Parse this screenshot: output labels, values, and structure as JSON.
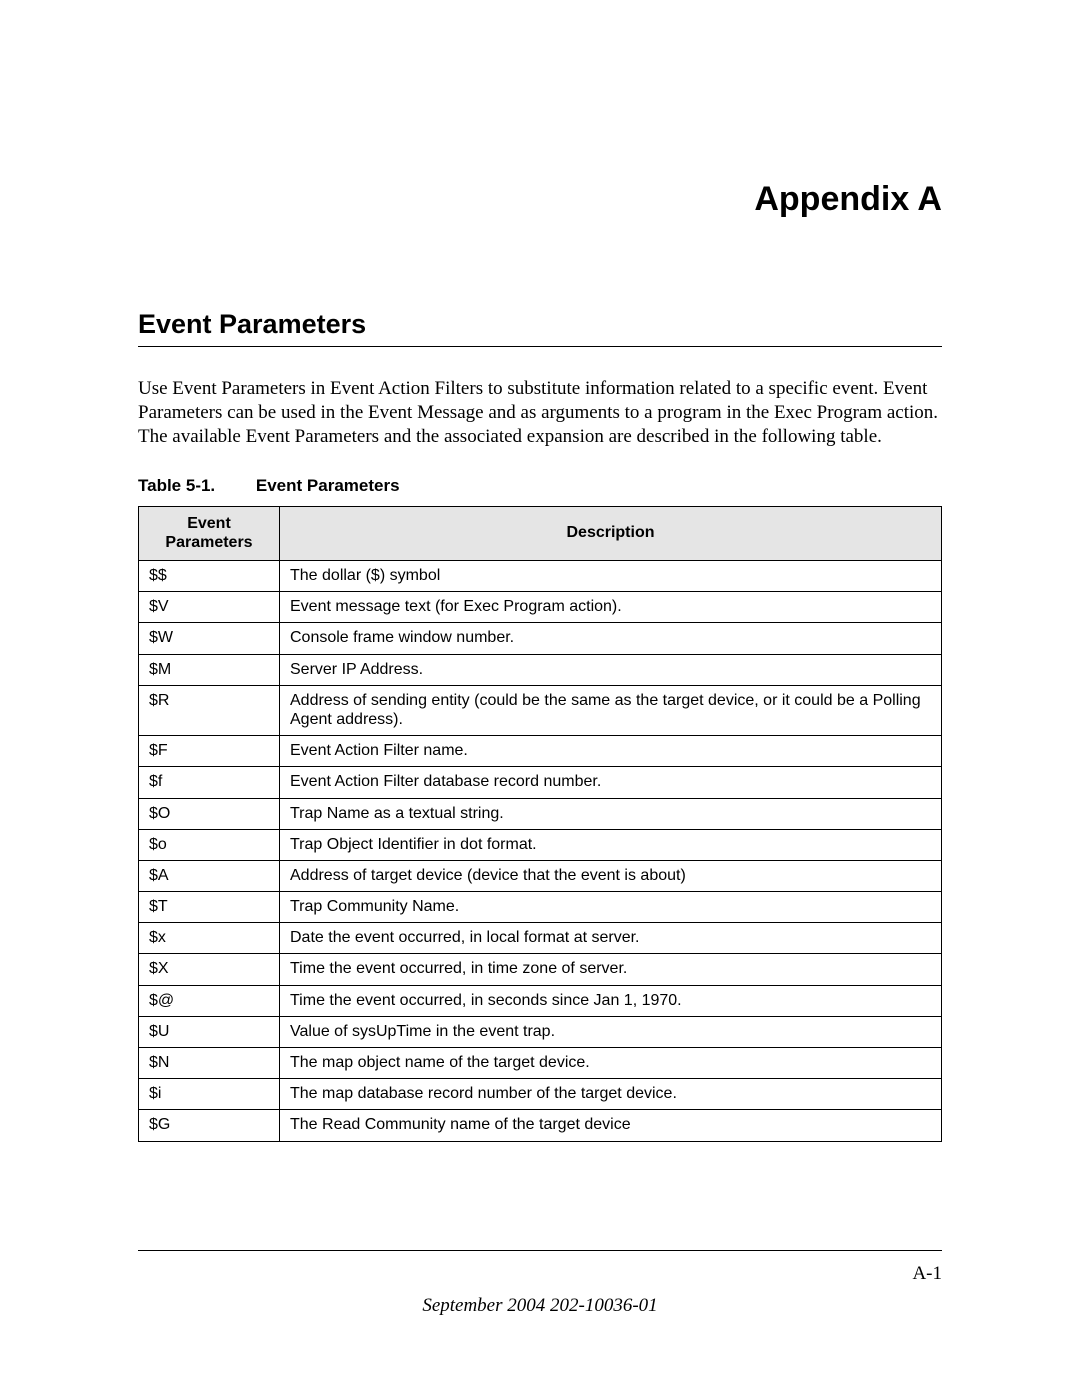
{
  "appendix_title": "Appendix A",
  "section_title": "Event Parameters",
  "intro_text": "Use Event Parameters in Event Action Filters to substitute information related to a specific event. Event Parameters can be used in the Event Message and as arguments to a program in the Exec Program action. The available Event Parameters and the associated expansion are described in the following table.",
  "table_caption_num": "Table 5-1.",
  "table_caption_title": "Event Parameters",
  "table_headers": {
    "param": "Event Parameters",
    "desc": "Description"
  },
  "rows": [
    {
      "param": "$$",
      "desc": "The dollar ($) symbol"
    },
    {
      "param": "$V",
      "desc": "Event message text (for Exec Program action)."
    },
    {
      "param": "$W",
      "desc": "Console frame window number."
    },
    {
      "param": "$M",
      "desc": "Server IP Address."
    },
    {
      "param": "$R",
      "desc": "Address of sending entity (could be the same as the target device, or it could be a Polling Agent address)."
    },
    {
      "param": "$F",
      "desc": "Event Action Filter name."
    },
    {
      "param": "$f",
      "desc": "Event Action Filter database record number."
    },
    {
      "param": "$O",
      "desc": "Trap Name as a textual string."
    },
    {
      "param": "$o",
      "desc": "Trap Object Identifier in dot format."
    },
    {
      "param": "$A",
      "desc": "Address of target device (device that the event is about)"
    },
    {
      "param": "$T",
      "desc": "Trap Community Name."
    },
    {
      "param": "$x",
      "desc": "Date the event occurred, in local format at server."
    },
    {
      "param": "$X",
      "desc": "Time the event occurred, in time zone of server."
    },
    {
      "param": "$@",
      "desc": "Time the event occurred, in seconds since Jan 1, 1970."
    },
    {
      "param": "$U",
      "desc": "Value of sysUpTime in the event trap."
    },
    {
      "param": "$N",
      "desc": "The map object name of the target device."
    },
    {
      "param": "$i",
      "desc": "The map database record number of the target device."
    },
    {
      "param": "$G",
      "desc": "The Read Community name of the target device"
    }
  ],
  "page_number": "A-1",
  "footer_text": "September 2004 202-10036-01"
}
